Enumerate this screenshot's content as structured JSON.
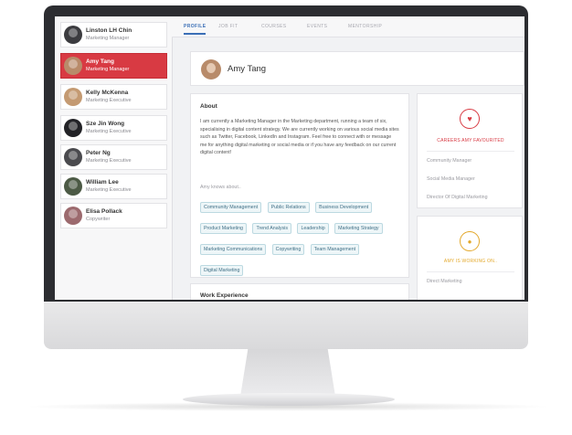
{
  "sidebar": {
    "people": [
      {
        "name": "Linston LH Chin",
        "role": "Marketing Manager",
        "active": false,
        "avatar_color": "#3b3b3f"
      },
      {
        "name": "Amy Tang",
        "role": "Marketing Manager",
        "active": true,
        "avatar_color": "#b88b6a"
      },
      {
        "name": "Kelly McKenna",
        "role": "Marketing Executive",
        "active": false,
        "avatar_color": "#c49a72"
      },
      {
        "name": "Sze Jin Wong",
        "role": "Marketing Executive",
        "active": false,
        "avatar_color": "#222226"
      },
      {
        "name": "Peter Ng",
        "role": "Marketing Executive",
        "active": false,
        "avatar_color": "#4a4a4e"
      },
      {
        "name": "William Lee",
        "role": "Marketing Executive",
        "active": false,
        "avatar_color": "#4c5a45"
      },
      {
        "name": "Elisa Pollack",
        "role": "Copywriter",
        "active": false,
        "avatar_color": "#9c6a6e"
      }
    ]
  },
  "tabs": [
    "PROFILE",
    "JOB FIT",
    "COURSES",
    "EVENTS",
    "MENTORSHIP"
  ],
  "active_tab": "PROFILE",
  "profile": {
    "name": "Amy Tang"
  },
  "about": {
    "title": "About",
    "text": "I am currently a Marketing Manager in the Marketing department, running a team of six, specialising in digital content strategy. We are currently working on various social media sites such as Twitter, Facebook, LinkedIn and Instagram. Feel free to connect with or message me for anything digital marketing or social media or if you have any feedback on our current digital content!",
    "knows_label": "Amy knows about..",
    "tags": [
      "Community Management",
      "Public Relations",
      "Business Development",
      "Product Marketing",
      "Trend Analysis",
      "Leadership",
      "Marketing Strategy",
      "Marketing Communications",
      "Copywriting",
      "Team Management",
      "Digital Marketing"
    ]
  },
  "work_experience": {
    "title": "Work Experience"
  },
  "favourites": {
    "heading": "CAREERS AMY FAVOURITED",
    "icon": "heart-icon",
    "items": [
      "Community Manager",
      "Social Media Manager",
      "Director Of Digital Marketing"
    ]
  },
  "working_on": {
    "heading": "AMY IS WORKING ON..",
    "icon": "coin-icon",
    "items": [
      "Direct Marketing"
    ]
  },
  "colors": {
    "accent": "#d83a43",
    "tab_active": "#3b6fb6",
    "working_on": "#e3a82b",
    "tag_text": "#3f6f86"
  }
}
